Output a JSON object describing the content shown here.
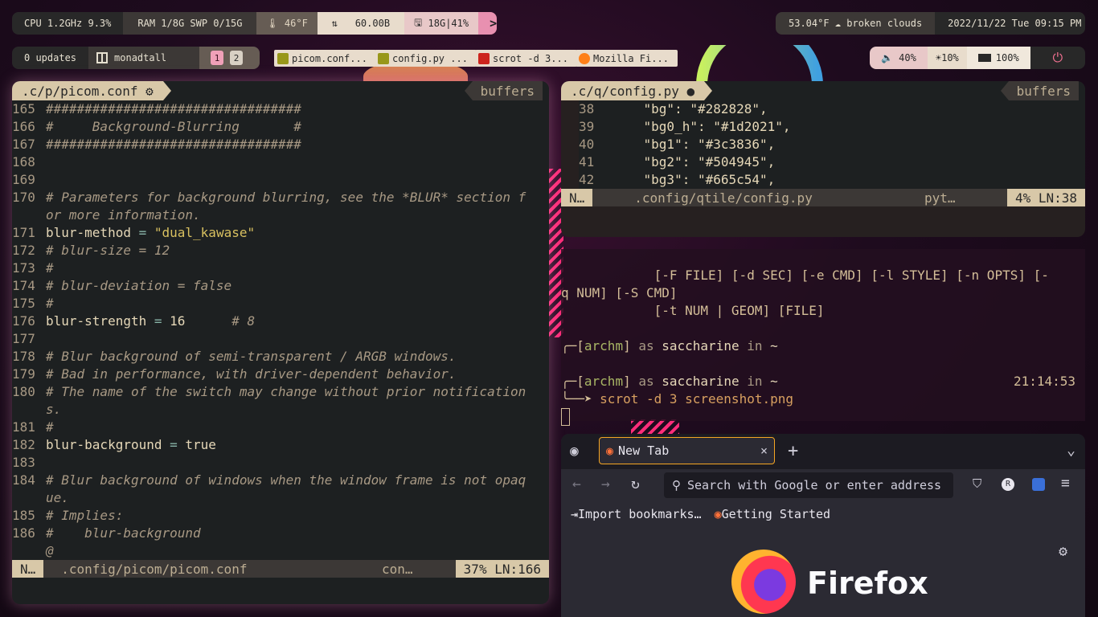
{
  "topbar": {
    "cpu": "CPU 1.2GHz 9.3%",
    "ram": "RAM 1/8G SWP 0/15G",
    "temp": "46°F",
    "net": "60.00B",
    "disk": "18G|41%",
    "terminal_glyph": ">_"
  },
  "weather": {
    "text": "53.04°F ☁ broken clouds",
    "datetime": "2022/11/22 Tue 09:15 PM"
  },
  "groups": {
    "updates": "0 updates",
    "layout": "monadtall",
    "g1": "1",
    "g2": "2"
  },
  "tasks": [
    {
      "label": "picom.conf...",
      "color": "#98971a"
    },
    {
      "label": "config.py ...",
      "color": "#98971a"
    },
    {
      "label": "scrot -d 3...",
      "color": "#cc241d"
    },
    {
      "label": "Mozilla Fi...",
      "color": "#fe8019"
    }
  ],
  "sys": {
    "volume": "40%",
    "brightness": "10%",
    "battery": "100%",
    "power": "⏻"
  },
  "left_editor": {
    "tab": ".c/p/picom.conf",
    "buffers": "buffers",
    "lines": [
      {
        "n": "165",
        "t": "#################################",
        "k": "cm"
      },
      {
        "n": "166",
        "t": "#     Background-Blurring       #",
        "k": "cm"
      },
      {
        "n": "167",
        "t": "#################################",
        "k": "cm"
      },
      {
        "n": "168",
        "t": "",
        "k": "cm"
      },
      {
        "n": "169",
        "t": "",
        "k": "cm"
      },
      {
        "n": "170",
        "t": "# Parameters for background blurring, see the *BLUR* section f",
        "k": "cm"
      },
      {
        "n": "",
        "t": "or more information.",
        "k": "cm"
      },
      {
        "n": "171",
        "k": "assign",
        "a": "blur-method",
        "o": " = ",
        "v": "\"dual_kawase\"",
        "vk": "str"
      },
      {
        "n": "172",
        "t": "# blur-size = 12",
        "k": "cm"
      },
      {
        "n": "173",
        "t": "#",
        "k": "cm"
      },
      {
        "n": "174",
        "t": "# blur-deviation = false",
        "k": "cm"
      },
      {
        "n": "175",
        "t": "#",
        "k": "cm"
      },
      {
        "n": "176",
        "k": "assign",
        "a": "blur-strength",
        "o": " = ",
        "v": "16",
        "vk": "num",
        "c": "      # 8"
      },
      {
        "n": "177",
        "t": "",
        "k": "cm"
      },
      {
        "n": "178",
        "t": "# Blur background of semi-transparent / ARGB windows.",
        "k": "cm"
      },
      {
        "n": "179",
        "t": "# Bad in performance, with driver-dependent behavior.",
        "k": "cm"
      },
      {
        "n": "180",
        "t": "# The name of the switch may change without prior notification",
        "k": "cm"
      },
      {
        "n": "",
        "t": "s.",
        "k": "cm"
      },
      {
        "n": "181",
        "t": "#",
        "k": "cm"
      },
      {
        "n": "182",
        "k": "assign",
        "a": "blur-background",
        "o": " = ",
        "v": "true",
        "vk": "num"
      },
      {
        "n": "183",
        "t": "",
        "k": "cm"
      },
      {
        "n": "184",
        "t": "# Blur background of windows when the window frame is not opaq",
        "k": "cm"
      },
      {
        "n": "",
        "t": "ue.",
        "k": "cm"
      },
      {
        "n": "185",
        "t": "# Implies:",
        "k": "cm"
      },
      {
        "n": "186",
        "t": "#    blur-background",
        "k": "cm"
      },
      {
        "n": "",
        "t": "@",
        "k": "cm"
      }
    ],
    "status": {
      "mode": "N…",
      "file": ".config/picom/picom.conf",
      "ft": "con…",
      "pos": "37% LN:166"
    }
  },
  "right_editor": {
    "tab": ".c/q/config.py",
    "buffers": "buffers",
    "lines": [
      {
        "n": "38",
        "k": "\"bg\"",
        "v": "\"#282828\","
      },
      {
        "n": "39",
        "k": "\"bg0_h\"",
        "v": "\"#1d2021\","
      },
      {
        "n": "40",
        "k": "\"bg1\"",
        "v": "\"#3c3836\","
      },
      {
        "n": "41",
        "k": "\"bg2\"",
        "v": "\"#504945\","
      },
      {
        "n": "42",
        "k": "\"bg3\"",
        "v": "\"#665c54\","
      }
    ],
    "status": {
      "mode": "N…",
      "file": ".config/qtile/config.py",
      "ft": "pyt…",
      "pos": "4% LN:38"
    }
  },
  "terminal": {
    "lines": [
      "            [-F FILE] [-d SEC] [-e CMD] [-l STYLE] [-n OPTS] [-",
      "q NUM] [-S CMD]",
      "            [-t NUM | GEOM] [FILE]"
    ],
    "prompt1": {
      "host": "archm",
      "as": " as ",
      "user": "saccharine",
      "in": " in ",
      "dir": "~"
    },
    "prompt2": {
      "host": "archm",
      "as": " as ",
      "user": "saccharine",
      "in": " in ",
      "dir": "~",
      "time": "21:14:53"
    },
    "command": "scrot -d 3 screenshot.png"
  },
  "firefox": {
    "tab_title": "New Tab",
    "url_placeholder": "Search with Google or enter address",
    "bookmarks": [
      "Import bookmarks…",
      "Getting Started"
    ],
    "brand": "Firefox"
  }
}
